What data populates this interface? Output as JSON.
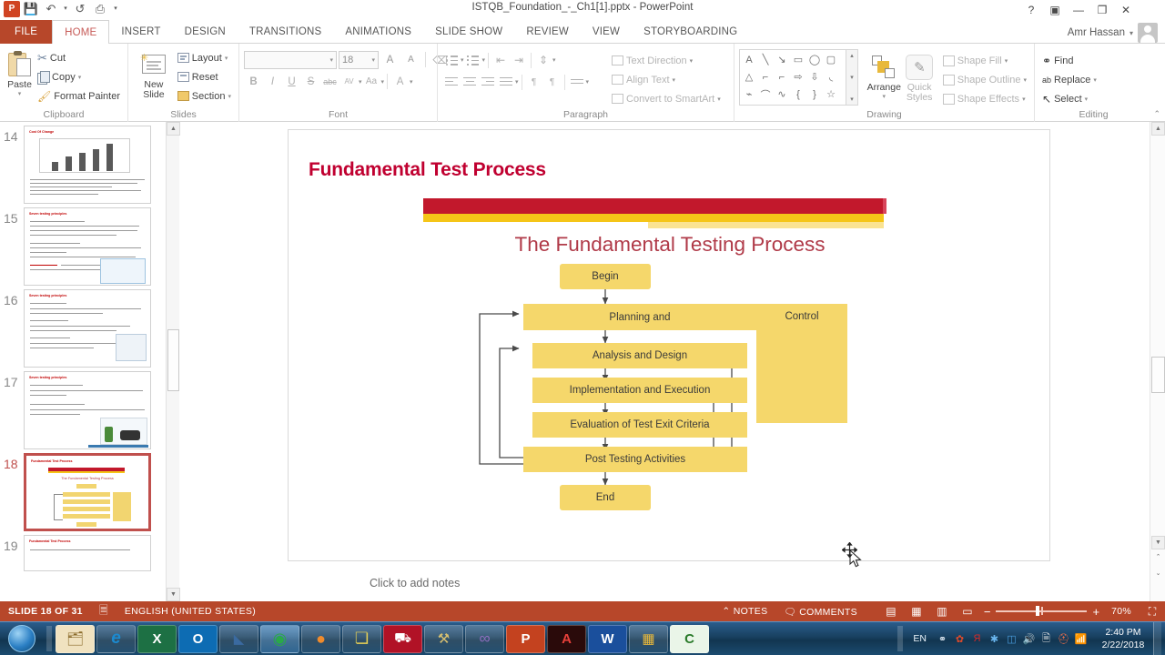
{
  "window": {
    "title": "ISTQB_Foundation_-_Ch1[1].pptx - PowerPoint",
    "help": "?",
    "ribbon_display": "▣",
    "minimize": "—",
    "restore": "❐",
    "close": "✕",
    "account_name": "Amr Hassan",
    "account_caret": "▾"
  },
  "qat": {
    "logo": "P",
    "save": "💾",
    "undo": "↶",
    "undo_caret": "▾",
    "redo": "↺",
    "start_show": "⎙",
    "customize": "▾"
  },
  "tabs": [
    {
      "label": "FILE",
      "id": "file"
    },
    {
      "label": "HOME",
      "id": "home"
    },
    {
      "label": "INSERT",
      "id": "insert"
    },
    {
      "label": "DESIGN",
      "id": "design"
    },
    {
      "label": "TRANSITIONS",
      "id": "transitions"
    },
    {
      "label": "ANIMATIONS",
      "id": "animations"
    },
    {
      "label": "SLIDE SHOW",
      "id": "slide-show"
    },
    {
      "label": "REVIEW",
      "id": "review"
    },
    {
      "label": "VIEW",
      "id": "view"
    },
    {
      "label": "STORYBOARDING",
      "id": "storyboarding"
    }
  ],
  "ribbon": {
    "collapse_arrow": "⌃",
    "clipboard": {
      "label": "Clipboard",
      "paste": "Paste",
      "paste_caret": "▾",
      "cut": "Cut",
      "copy": "Copy",
      "copy_caret": "▾",
      "format_painter": "Format Painter",
      "launcher": "◸"
    },
    "slides": {
      "label": "Slides",
      "new_slide": "New",
      "new_slide2": "Slide",
      "new_slide_caret": "▾",
      "layout": "Layout",
      "layout_caret": "▾",
      "reset": "Reset",
      "section": "Section",
      "section_caret": "▾"
    },
    "font": {
      "label": "Font",
      "font_name": "",
      "font_name_caret": "▾",
      "font_size": "18",
      "font_size_caret": "▾",
      "grow": "A",
      "shrink": "A",
      "clear_format": "⌫",
      "bold": "B",
      "italic": "I",
      "underline": "U",
      "shadow": "S",
      "strike": "abc",
      "spacing": "AV",
      "spacing_caret": "▾",
      "change_case": "Aa",
      "case_caret": "▾",
      "font_color": "A",
      "color_caret": "▾",
      "launcher": "◸"
    },
    "paragraph": {
      "label": "Paragraph",
      "bullets_caret": "▾",
      "numbering_caret": "▾",
      "decrease_indent": "⇤",
      "increase_indent": "⇥",
      "line_spacing": "⇕",
      "line_spacing_caret": "▾",
      "align_left": "≡",
      "align_center": "≡",
      "align_right": "≡",
      "justify": "≡",
      "columns_caret": "▾",
      "ltr": "¶",
      "rtl": "¶",
      "align_vert_caret": "▾",
      "text_direction": "Text Direction",
      "text_direction_caret": "▾",
      "align_text": "Align Text",
      "align_text_caret": "▾",
      "convert_smartart": "Convert to SmartArt",
      "smartart_caret": "▾",
      "launcher": "◸"
    },
    "drawing": {
      "label": "Drawing",
      "shapes": [
        "A",
        "╲",
        "↘",
        "▭",
        "◯",
        "▢",
        "△",
        "⌐",
        "⌐",
        "⇨",
        "⇩",
        "◟",
        "⌁",
        "⌒",
        "∿",
        "{",
        "}",
        "☆"
      ],
      "gallery_up": "▴",
      "gallery_down": "▾",
      "gallery_more": "▾",
      "arrange": "Arrange",
      "arrange_caret": "▾",
      "quick_styles": "Quick",
      "quick_styles2": "Styles",
      "quick_caret": "▾",
      "shape_fill": "Shape Fill",
      "shape_fill_caret": "▾",
      "shape_outline": "Shape Outline",
      "shape_outline_caret": "▾",
      "shape_effects": "Shape Effects",
      "shape_effects_caret": "▾",
      "launcher": "◸"
    },
    "editing": {
      "label": "Editing",
      "find": "Find",
      "replace": "Replace",
      "replace_caret": "▾",
      "select": "Select",
      "select_caret": "▾"
    }
  },
  "thumbnails": [
    {
      "num": "14",
      "title": "Cost Of Change",
      "selected": false,
      "kind": "chart"
    },
    {
      "num": "15",
      "title": "Seven testing principles",
      "selected": false,
      "kind": "text-img"
    },
    {
      "num": "16",
      "title": "Seven testing principles",
      "selected": false,
      "kind": "text-img2"
    },
    {
      "num": "17",
      "title": "Seven testing principles",
      "selected": false,
      "kind": "text-img3"
    },
    {
      "num": "18",
      "title": "Fundamental Test Process",
      "selected": true,
      "kind": "diagram"
    },
    {
      "num": "19",
      "title": "Fundamental Test Process",
      "selected": false,
      "kind": "text"
    }
  ],
  "pane_scroll": {
    "up": "▲",
    "down": "▼"
  },
  "editor_scroll": {
    "up": "▲",
    "down": "▼",
    "prev_slide": "⌃",
    "next_slide": "⌄"
  },
  "slide": {
    "title": "Fundamental Test Process",
    "subtitle": "The Fundamental Testing Process",
    "diagram": {
      "begin": "Begin",
      "planning": "Planning and",
      "analysis": "Analysis and Design",
      "implementation": "Implementation and Execution",
      "evaluation": "Evaluation of Test Exit Criteria",
      "post_testing": "Post Testing Activities",
      "end": "End",
      "control": "Control"
    },
    "box_color": "#f5d76b",
    "accent_red": "#c2182c",
    "accent_yellow": "#f5c518",
    "title_color": "#c00030"
  },
  "notes": {
    "placeholder": "Click to add notes"
  },
  "status": {
    "slide_counter": "SLIDE 18 OF 31",
    "language": "ENGLISH (UNITED STATES)",
    "spellcheck_icon": "🗏",
    "notes": "NOTES",
    "comments": "COMMENTS",
    "view_normal": "▤",
    "view_sorter": "▦",
    "view_reading": "▥",
    "view_slideshow": "▭",
    "zoom_out": "−",
    "zoom_in": "+",
    "zoom_level": "70%",
    "fit_slide": "⛶"
  },
  "taskbar": {
    "start": "start-orb",
    "items": [
      {
        "icon": "🗂",
        "name": "explorer-pinned",
        "active": false
      },
      {
        "icon": "e",
        "name": "internet-explorer",
        "active": false
      },
      {
        "icon": "X",
        "name": "excel",
        "active": false
      },
      {
        "icon": "O",
        "name": "outlook",
        "active": true
      },
      {
        "icon": "◣",
        "name": "media-player",
        "active": false
      },
      {
        "icon": "◉",
        "name": "chrome",
        "active": true
      },
      {
        "icon": "●",
        "name": "firefox",
        "active": false
      },
      {
        "icon": "❏",
        "name": "sticky-notes",
        "active": false
      },
      {
        "icon": "⛟",
        "name": "red-app",
        "active": true
      },
      {
        "icon": "⚒",
        "name": "tools-app",
        "active": false
      },
      {
        "icon": "∞",
        "name": "visual-studio",
        "active": false
      },
      {
        "icon": "P",
        "name": "powerpoint",
        "active": true
      },
      {
        "icon": "A",
        "name": "adobe-acrobat",
        "active": true
      },
      {
        "icon": "W",
        "name": "word",
        "active": false
      },
      {
        "icon": "▦",
        "name": "windows-app",
        "active": false
      },
      {
        "icon": "C",
        "name": "camtasia",
        "active": true
      }
    ],
    "tray": {
      "language": "EN",
      "icons": [
        "⚭",
        "✿",
        "Я",
        "✱",
        "◫",
        "🔊",
        "🗎",
        "⛑",
        "📶"
      ],
      "time": "2:40 PM",
      "date": "2/22/2018"
    }
  }
}
